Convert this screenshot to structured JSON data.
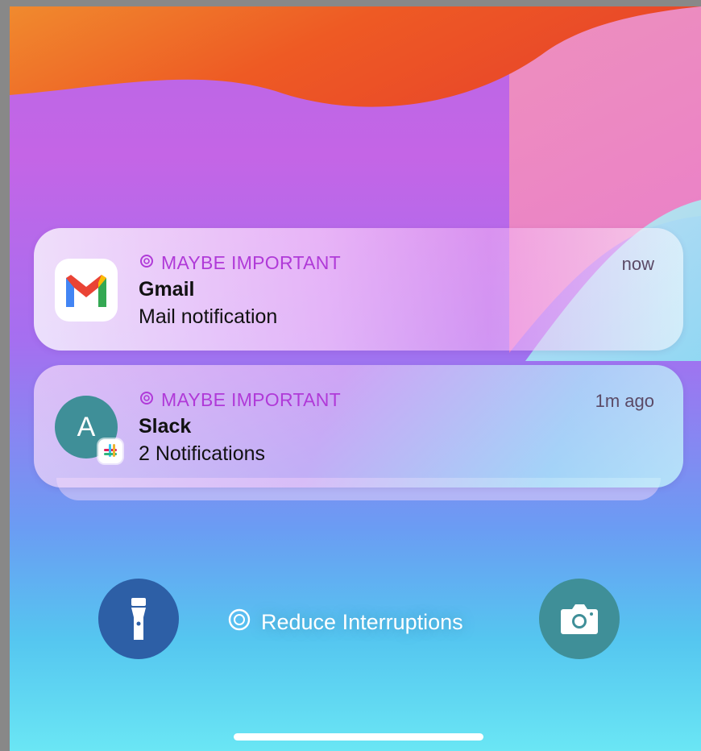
{
  "notifications": [
    {
      "app": "Gmail",
      "category": "MAYBE IMPORTANT",
      "body": "Mail notification",
      "time": "now",
      "icon": "gmail-icon"
    },
    {
      "app": "Slack",
      "category": "MAYBE IMPORTANT",
      "body": "2 Notifications",
      "time": "1m ago",
      "avatar_letter": "A",
      "icon": "slack-icon"
    }
  ],
  "lockscreen": {
    "focus_label": "Reduce Interruptions",
    "left_button": "flashlight-icon",
    "right_button": "camera-icon"
  },
  "colors": {
    "category_label": "#b03ad8",
    "flashlight_button": "#2d5fa6",
    "camera_button": "#3f8f98",
    "avatar": "#3f8f98"
  }
}
